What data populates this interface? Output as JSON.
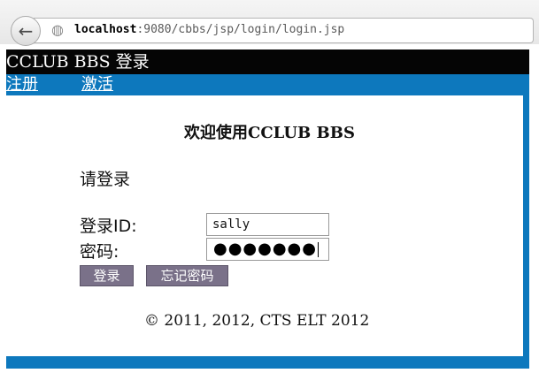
{
  "browser": {
    "back_icon": "back-arrow-icon",
    "back_glyph": "←",
    "site_icon": "globe-icon",
    "globe_glyph": "◍",
    "url_host": "localhost",
    "url_path": ":9080/cbbs/jsp/login/login.jsp"
  },
  "header": {
    "title": "CCLUB BBS 登录"
  },
  "nav": {
    "register": "注册",
    "activate": "激活"
  },
  "main": {
    "welcome": "欢迎使用CCLUB BBS",
    "prompt": "请登录",
    "login_id_label": "登录ID:",
    "login_id_value": "sally",
    "password_label": "密码:",
    "password_mask": "●●●●●●●",
    "login_button": "登录",
    "forgot_button": "忘记密码",
    "copyright": "© 2011, 2012, CTS ELT 2012"
  },
  "colors": {
    "frame_blue": "#0d78bd",
    "title_bar": "#050505",
    "button": "#7a7189"
  }
}
